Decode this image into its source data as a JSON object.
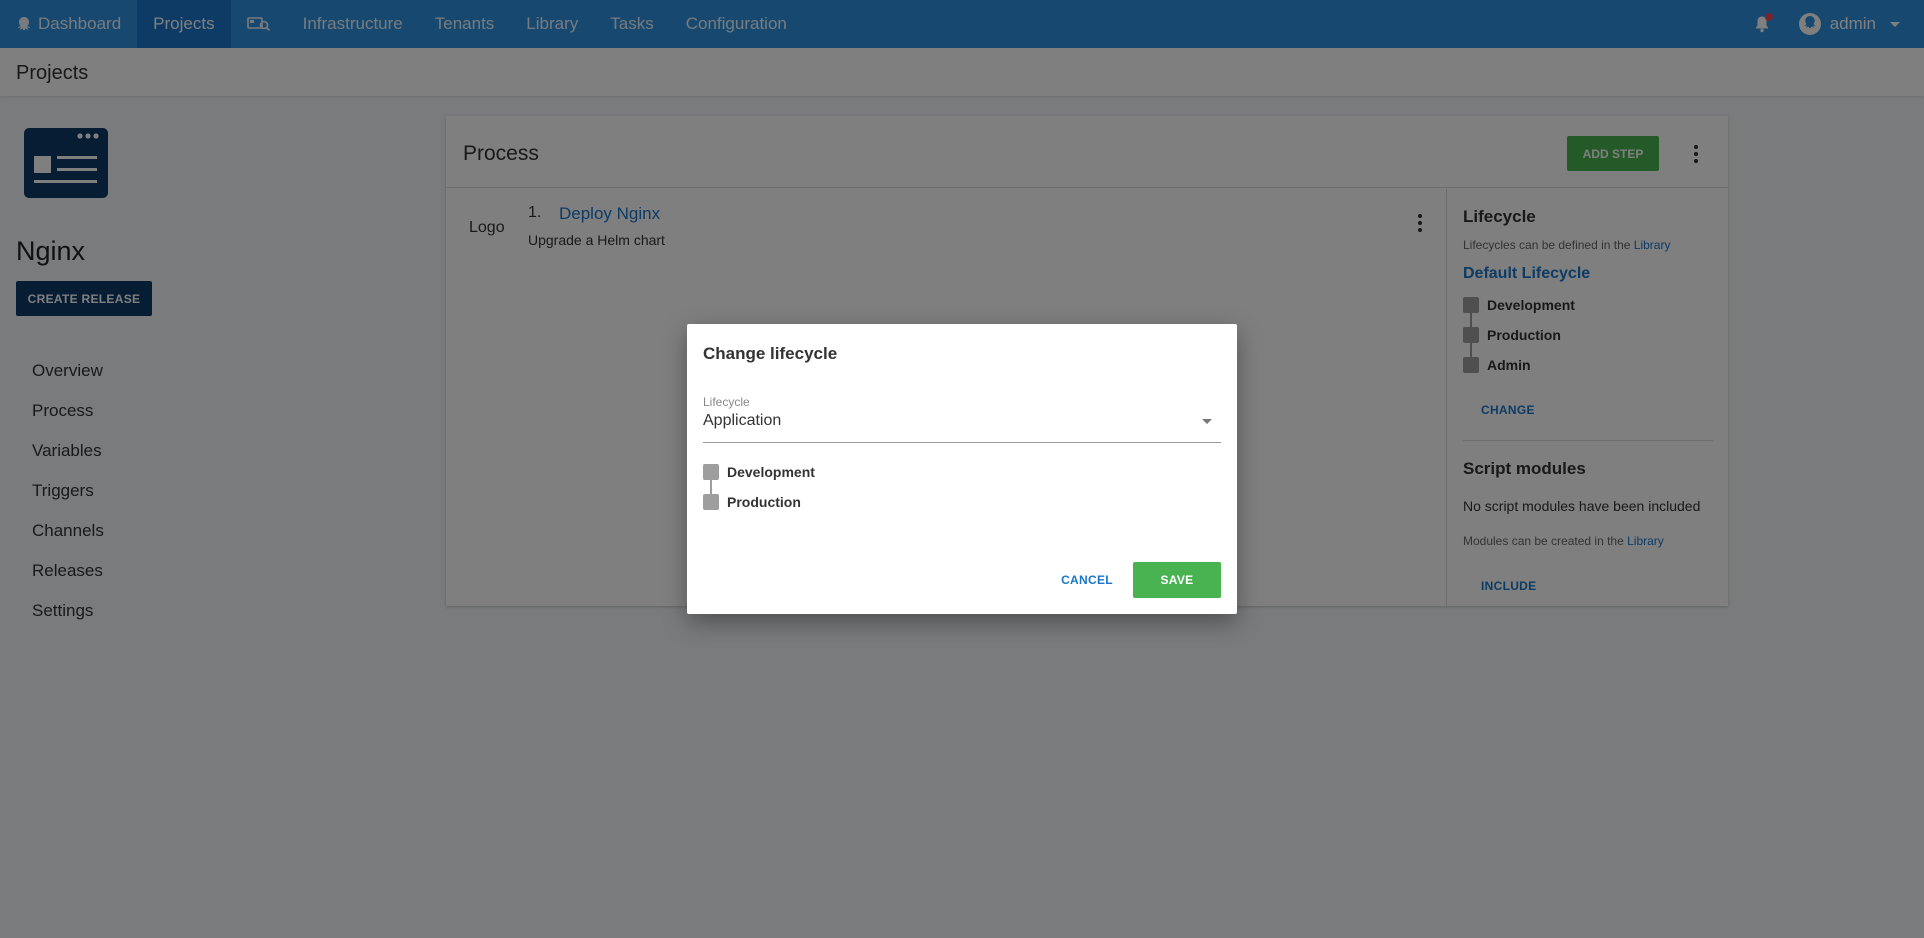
{
  "topnav": {
    "items": [
      {
        "label": "Dashboard",
        "icon": "octopus-icon"
      },
      {
        "label": "Projects"
      },
      {
        "label": "",
        "icon": "search-machine-icon"
      },
      {
        "label": "Infrastructure"
      },
      {
        "label": "Tenants"
      },
      {
        "label": "Library"
      },
      {
        "label": "Tasks"
      },
      {
        "label": "Configuration"
      }
    ],
    "active": "Projects",
    "user": "admin",
    "notification_icon": "bell-icon",
    "colors": {
      "bar": "#2f93e0",
      "active": "#1a77ca"
    }
  },
  "breadcrumb": "Projects",
  "sidebar": {
    "project_name": "Nginx",
    "create_release_label": "CREATE RELEASE",
    "items": [
      "Overview",
      "Process",
      "Variables",
      "Triggers",
      "Channels",
      "Releases",
      "Settings"
    ]
  },
  "process": {
    "title": "Process",
    "add_step_label": "ADD STEP",
    "steps": [
      {
        "logo_text": "Logo",
        "number": "1.",
        "name": "Deploy Nginx",
        "description": "Upgrade a Helm chart"
      }
    ]
  },
  "lifecycle_panel": {
    "title": "Lifecycle",
    "hint_prefix": "Lifecycles can be defined in the ",
    "hint_link": "Library",
    "current": "Default Lifecycle",
    "phases": [
      "Development",
      "Production",
      "Admin"
    ],
    "change_label": "CHANGE"
  },
  "script_modules": {
    "title": "Script modules",
    "empty_text": "No script modules have been included",
    "hint_prefix": "Modules can be created in the ",
    "hint_link": "Library",
    "include_label": "INCLUDE"
  },
  "dialog": {
    "title": "Change lifecycle",
    "field_label": "Lifecycle",
    "field_value": "Application",
    "phases": [
      "Development",
      "Production"
    ],
    "cancel_label": "CANCEL",
    "save_label": "SAVE"
  }
}
